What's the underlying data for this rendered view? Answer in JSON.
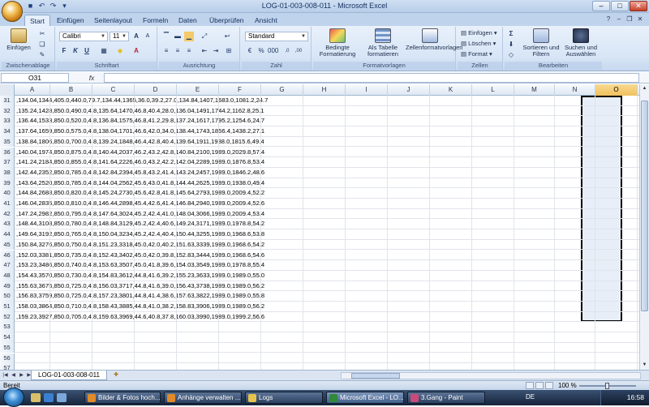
{
  "window": {
    "title": "LOG-01-003-008-011 - Microsoft Excel"
  },
  "ribbon": {
    "tabs": [
      "Start",
      "Einfügen",
      "Seitenlayout",
      "Formeln",
      "Daten",
      "Überprüfen",
      "Ansicht"
    ],
    "clipboard": {
      "paste": "Einfügen",
      "label": "Zwischenablage"
    },
    "font": {
      "name": "Calibri",
      "size": "11",
      "bold": "F",
      "italic": "K",
      "underline": "U",
      "label": "Schriftart"
    },
    "alignment": {
      "label": "Ausrichtung"
    },
    "number": {
      "format": "Standard",
      "label": "Zahl"
    },
    "styles": {
      "conditional": "Bedingte Formatierung",
      "as_table": "Als Tabelle formatieren",
      "cell_styles": "Zellenformatvorlagen",
      "label": "Formatvorlagen"
    },
    "cells": {
      "insert": "Einfügen",
      "delete": "Löschen",
      "format": "Format",
      "label": "Zellen"
    },
    "editing": {
      "sort": "Sortieren und Filtern",
      "find": "Suchen und Auswählen",
      "label": "Bearbeiten"
    }
  },
  "formula_bar": {
    "name_box": "O31",
    "fx": "fx",
    "value": ""
  },
  "columns": [
    "A",
    "B",
    "C",
    "D",
    "E",
    "F",
    "G",
    "H",
    "I",
    "J",
    "K",
    "L",
    "M",
    "N",
    "O"
  ],
  "selected_column": "O",
  "rows": [
    {
      "num": "31",
      "text": ",134.04,1344,405.0,440.0,79.7,134.44,1365,36.0,39.2,27.0,134.84,1407,1683.0,1081.2,24.7"
    },
    {
      "num": "32",
      "text": ",135.24,1428,850.0,490.0,4.8,135.64,1470,46.8,40.4,28.0,136.04,1491,1744.2,1162.8,25.1"
    },
    {
      "num": "33",
      "text": ",136.44,1533,850.0,520.0,4.8,136.84,1575,46.8,41.2,29.8,137.24,1617,1795.2,1254.6,24.7"
    },
    {
      "num": "34",
      "text": ",137.64,1659,850.0,575.0,4.8,138.04,1701,46.6,42.0,34.0,138.44,1743,1856.4,1438.2,27.1"
    },
    {
      "num": "35",
      "text": ",138.84,1806,850.0,700.0,4.8,139.24,1848,46.4,42.8,40.4,139.64,1911,1938.0,1815.6,49.4"
    },
    {
      "num": "36",
      "text": ",140.04,1974,850.0,875.0,4.8,140.44,2037,46.2,43.2,42.8,140.84,2100,1989.0,2029.8,57.4"
    },
    {
      "num": "37",
      "text": ",141.24,2184,850.0,855.0,4.8,141.64,2226,46.0,43.2,42.2,142.04,2289,1989.0,1876.8,53.4"
    },
    {
      "num": "38",
      "text": ",142.44,2352,850.0,785.0,4.8,142.84,2394,45.8,43.2,41.4,143.24,2457,1989.0,1846.2,48.6"
    },
    {
      "num": "39",
      "text": ",143.64,2520,850.0,785.0,4.8,144.04,2562,45.6,43.0,41.8,144.44,2625,1989.0,1938.0,49.4"
    },
    {
      "num": "40",
      "text": ",144.84,2688,850.0,820.0,4.8,145.24,2730,45.6,42.8,41.8,145.64,2793,1989.0,2009.4,52.2"
    },
    {
      "num": "41",
      "text": ",146.04,2835,850.0,810.0,4.8,146.44,2898,45.4,42.6,41.4,146.84,2940,1989.0,2009.4,52.6"
    },
    {
      "num": "42",
      "text": ",147.24,2982,850.0,795.0,4.8,147.64,3024,45.2,42.4,41.0,148.04,3066,1989.0,2009.4,53.4"
    },
    {
      "num": "43",
      "text": ",148.44,3108,850.0,780.0,4.8,148.84,3129,45.2,42.4,40.6,149.24,3171,1989.0,1978.8,54.2"
    },
    {
      "num": "44",
      "text": ",149.64,3192,850.0,765.0,4.8,150.04,3234,45.2,42.4,40.4,150.44,3255,1989.0,1968.6,53.8"
    },
    {
      "num": "45",
      "text": ",150.84,3276,850.0,750.0,4.8,151.23,3318,45.0,42.0,40.2,151.63,3339,1989.0,1968.6,54.2"
    },
    {
      "num": "46",
      "text": ",152.03,3381,850.0,735.0,4.8,152.43,3402,45.0,42.0,39.8,152.83,3444,1989.0,1968.6,54.6"
    },
    {
      "num": "47",
      "text": ",153.23,3486,850.0,740.0,4.8,153.63,3507,45.0,41.8,39.6,154.03,3549,1989.0,1978.8,55.4"
    },
    {
      "num": "48",
      "text": ",154.43,3570,850.0,730.0,4.8,154.83,3612,44.8,41.6,39.2,155.23,3633,1989.0,1989.0,55.0"
    },
    {
      "num": "49",
      "text": ",155.63,3675,850.0,725.0,4.8,156.03,3717,44.8,41.6,39.0,156.43,3738,1989.0,1989.0,56.2"
    },
    {
      "num": "50",
      "text": ",156.83,3759,850.0,725.0,4.8,157.23,3801,44.8,41.4,38.6,157.63,3822,1989.0,1989.0,55.8"
    },
    {
      "num": "51",
      "text": ",158.03,3864,850.0,710.0,4.8,158.43,3885,44.8,41.0,38.2,158.83,3906,1989.0,1989.0,56.2"
    },
    {
      "num": "52",
      "text": ",159.23,3927,850.0,705.0,4.8,159.63,3969,44.6,40.8,37.8,160.03,3990,1989.0,1999.2,56.6"
    },
    {
      "num": "53",
      "text": ""
    },
    {
      "num": "54",
      "text": ""
    },
    {
      "num": "55",
      "text": ""
    },
    {
      "num": "56",
      "text": ""
    },
    {
      "num": "57",
      "text": ""
    }
  ],
  "sheet_tab": "LOG-01-003-008-011",
  "status": {
    "text": "Bereit",
    "zoom": "100 %"
  },
  "taskbar": {
    "tasks": [
      "Bilder & Fotos hoch...",
      "Anhänge verwalten ...",
      "Logs",
      "Microsoft Excel - LO...",
      "3.Gang - Paint"
    ],
    "lang": "DE",
    "clock": "16:58"
  }
}
